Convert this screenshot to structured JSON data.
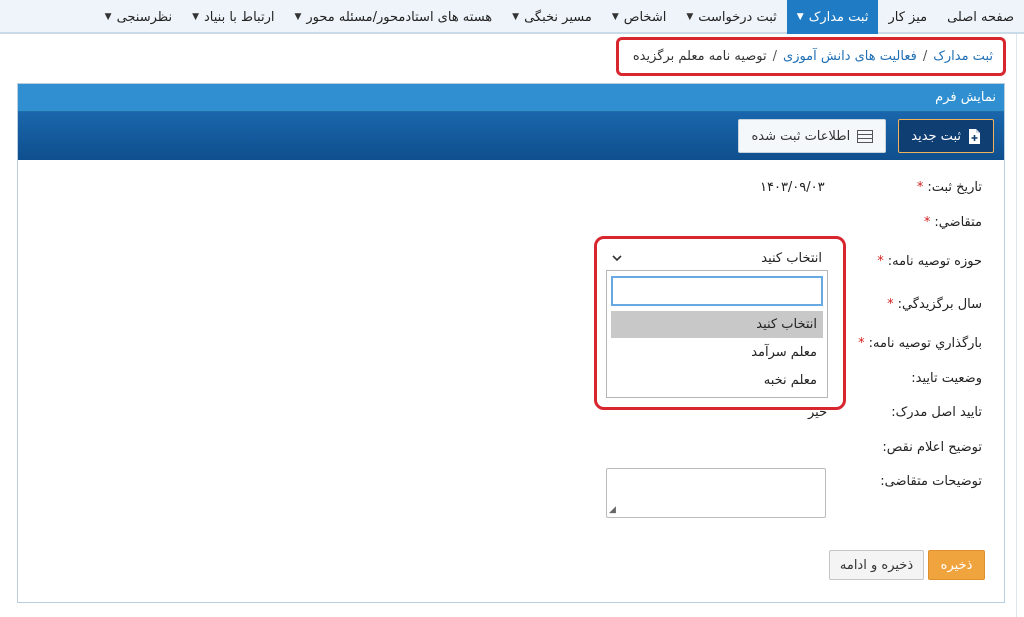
{
  "nav": {
    "items": [
      {
        "label": "صفحه اصلی",
        "has_caret": false,
        "active": false
      },
      {
        "label": "میز کار",
        "has_caret": false,
        "active": false
      },
      {
        "label": "ثبت مدارک",
        "has_caret": true,
        "active": true
      },
      {
        "label": "ثبت درخواست",
        "has_caret": true,
        "active": false
      },
      {
        "label": "اشخاص",
        "has_caret": true,
        "active": false
      },
      {
        "label": "مسیر نخبگی",
        "has_caret": true,
        "active": false
      },
      {
        "label": "هسته های استادمحور/مسئله محور",
        "has_caret": true,
        "active": false
      },
      {
        "label": "ارتباط با بنیاد",
        "has_caret": true,
        "active": false
      },
      {
        "label": "نظرسنجی",
        "has_caret": true,
        "active": false
      }
    ]
  },
  "breadcrumb": {
    "item1": "ثبت مدارک",
    "item2": "فعالیت های دانش آموزی",
    "current": "توصیه نامه معلم برگزیده",
    "separator": "/"
  },
  "panel": {
    "title": "نمایش فرم",
    "new_button": "ثبت جدید",
    "records_button": "اطلاعات ثبت شده"
  },
  "form": {
    "date_label": "تاریخ ثبت:",
    "date_value": "۱۴۰۳/۰۹/۰۳",
    "applicant_label": "متقاضي:",
    "field_label": "حوزه توصیه نامه:",
    "year_label": "سال برگزيدگي:",
    "upload_label": "بارگذاري توصیه نامه:",
    "approval_label": "وضعیت تایید:",
    "original_label": "تایید اصل مدرک:",
    "original_value": "خیر",
    "defect_label": "توضیح اعلام نقص:",
    "notes_label": "توضیحات متقاضی:",
    "required_mark": "*"
  },
  "dropdown": {
    "selected": "انتخاب کنید",
    "search_value": "",
    "options": [
      "انتخاب کنید",
      "معلم سرآمد",
      "معلم نخبه"
    ]
  },
  "buttons": {
    "save": "ذخیره",
    "save_continue": "ذخیره و ادامه"
  },
  "colors": {
    "nav_active": "#1f7cc4",
    "panel_header": "#2f8fd0",
    "toolbar": "#0f4f8e",
    "highlight_outline": "#d7262e",
    "save_button": "#f0a43e",
    "required": "#d21e1e"
  }
}
